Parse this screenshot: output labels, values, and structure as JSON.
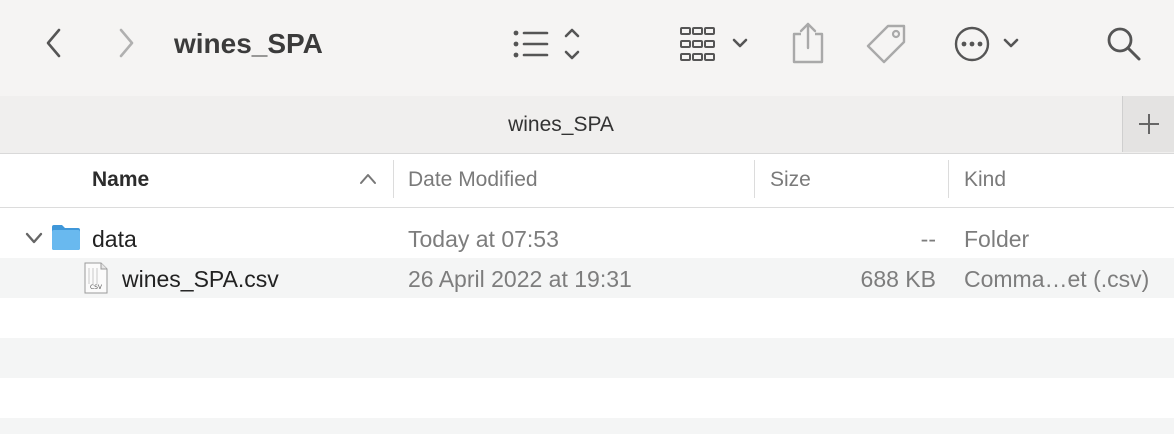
{
  "window": {
    "title": "wines_SPA"
  },
  "tab": {
    "title": "wines_SPA"
  },
  "columns": {
    "name": "Name",
    "date_modified": "Date Modified",
    "size": "Size",
    "kind": "Kind"
  },
  "rows": [
    {
      "name": "data",
      "date": "Today at 07:53",
      "size": "--",
      "kind": "Folder",
      "icon": "folder-icon",
      "expanded": true
    },
    {
      "name": "wines_SPA.csv",
      "date": "26 April 2022 at 19:31",
      "size": "688 KB",
      "kind": "Comma…et (.csv)",
      "icon": "csv-file-icon",
      "file_badge": "CSV"
    }
  ],
  "colors": {
    "toolbar_bg": "#f5f4f3",
    "folder_blue": "#5aaee6",
    "row_alt": "#f4f5f5"
  }
}
